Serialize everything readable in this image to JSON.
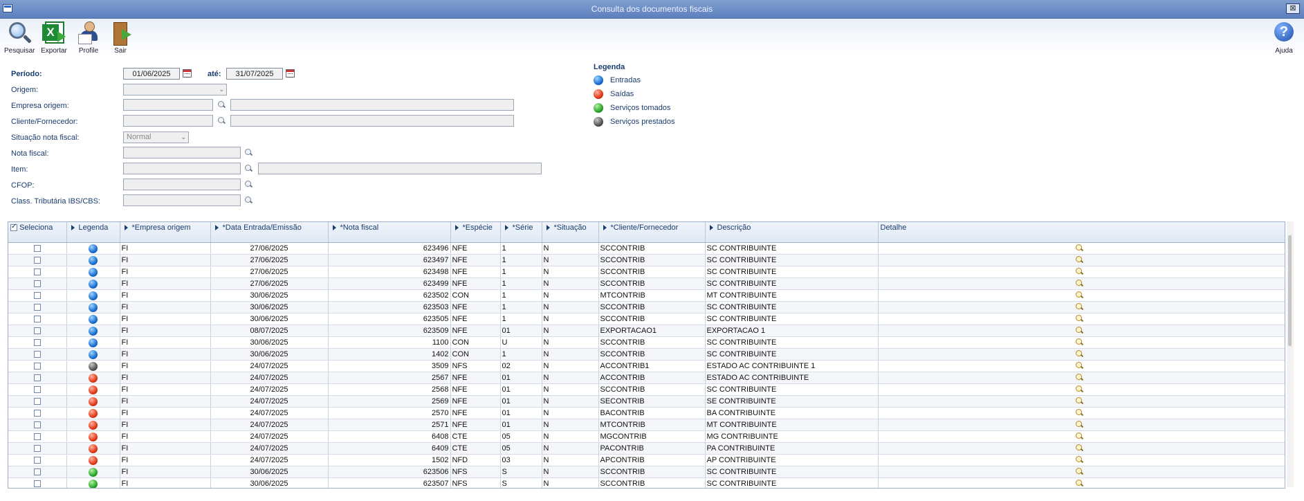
{
  "window": {
    "title": "Consulta dos documentos fiscais",
    "close_label": "⊠"
  },
  "toolbar": {
    "search_label": "Pesquisar",
    "export_label": "Exportar",
    "profile_label": "Profile",
    "exit_label": "Sair",
    "help_label": "Ajuda"
  },
  "filters": {
    "periodo_label": "Período:",
    "periodo_start": "01/06/2025",
    "ate_label": "até:",
    "periodo_end": "31/07/2025",
    "origem_label": "Origem:",
    "origem_value": "",
    "empresa_origem_label": "Empresa origem:",
    "empresa_origem_code": "",
    "empresa_origem_name": "",
    "cliente_label": "Cliente/Fornecedor:",
    "cliente_code": "",
    "cliente_name": "",
    "situacao_label": "Situação nota fiscal:",
    "situacao_value": "Normal",
    "nota_fiscal_label": "Nota fiscal:",
    "nota_fiscal_value": "",
    "item_label": "Item:",
    "item_code": "",
    "item_name": "",
    "cfop_label": "CFOP:",
    "cfop_value": "",
    "class_trib_label": "Class. Tributária IBS/CBS:",
    "class_trib_value": ""
  },
  "legend": {
    "title": "Legenda",
    "items": [
      {
        "label": "Entradas",
        "color": "blue"
      },
      {
        "label": "Saídas",
        "color": "red"
      },
      {
        "label": "Serviços tomados",
        "color": "green"
      },
      {
        "label": "Serviços prestados",
        "color": "gray"
      }
    ]
  },
  "grid": {
    "columns": [
      "Seleciona",
      "Legenda",
      "*Empresa origem",
      "*Data Entrada/Emissão",
      "*Nota fiscal",
      "*Espécie",
      "*Série",
      "*Situação",
      "*Cliente/Fornecedor",
      "Descrição",
      "Detalhe"
    ],
    "rows": [
      {
        "legend": "blue",
        "empresa": "FI",
        "data": "27/06/2025",
        "nota": "623496",
        "especie": "NFE",
        "serie": "1",
        "situacao": "N",
        "cliente": "SCCONTRIB",
        "descricao": "SC CONTRIBUINTE"
      },
      {
        "legend": "blue",
        "empresa": "FI",
        "data": "27/06/2025",
        "nota": "623497",
        "especie": "NFE",
        "serie": "1",
        "situacao": "N",
        "cliente": "SCCONTRIB",
        "descricao": "SC CONTRIBUINTE"
      },
      {
        "legend": "blue",
        "empresa": "FI",
        "data": "27/06/2025",
        "nota": "623498",
        "especie": "NFE",
        "serie": "1",
        "situacao": "N",
        "cliente": "SCCONTRIB",
        "descricao": "SC CONTRIBUINTE"
      },
      {
        "legend": "blue",
        "empresa": "FI",
        "data": "27/06/2025",
        "nota": "623499",
        "especie": "NFE",
        "serie": "1",
        "situacao": "N",
        "cliente": "SCCONTRIB",
        "descricao": "SC CONTRIBUINTE"
      },
      {
        "legend": "blue",
        "empresa": "FI",
        "data": "30/06/2025",
        "nota": "623502",
        "especie": "CON",
        "serie": "1",
        "situacao": "N",
        "cliente": "MTCONTRIB",
        "descricao": "MT CONTRIBUINTE"
      },
      {
        "legend": "blue",
        "empresa": "FI",
        "data": "30/06/2025",
        "nota": "623503",
        "especie": "NFE",
        "serie": "1",
        "situacao": "N",
        "cliente": "SCCONTRIB",
        "descricao": "SC CONTRIBUINTE"
      },
      {
        "legend": "blue",
        "empresa": "FI",
        "data": "30/06/2025",
        "nota": "623505",
        "especie": "NFE",
        "serie": "1",
        "situacao": "N",
        "cliente": "SCCONTRIB",
        "descricao": "SC CONTRIBUINTE"
      },
      {
        "legend": "blue",
        "empresa": "FI",
        "data": "08/07/2025",
        "nota": "623509",
        "especie": "NFE",
        "serie": "01",
        "situacao": "N",
        "cliente": "EXPORTACAO1",
        "descricao": "EXPORTACAO 1"
      },
      {
        "legend": "blue",
        "empresa": "FI",
        "data": "30/06/2025",
        "nota": "1100",
        "especie": "CON",
        "serie": "U",
        "situacao": "N",
        "cliente": "SCCONTRIB",
        "descricao": "SC CONTRIBUINTE"
      },
      {
        "legend": "blue",
        "empresa": "FI",
        "data": "30/06/2025",
        "nota": "1402",
        "especie": "CON",
        "serie": "1",
        "situacao": "N",
        "cliente": "SCCONTRIB",
        "descricao": "SC CONTRIBUINTE"
      },
      {
        "legend": "gray",
        "empresa": "FI",
        "data": "24/07/2025",
        "nota": "3509",
        "especie": "NFS",
        "serie": "02",
        "situacao": "N",
        "cliente": "ACCONTRIB1",
        "descricao": "ESTADO AC CONTRIBUINTE 1"
      },
      {
        "legend": "red",
        "empresa": "FI",
        "data": "24/07/2025",
        "nota": "2567",
        "especie": "NFE",
        "serie": "01",
        "situacao": "N",
        "cliente": "ACCONTRIB",
        "descricao": "ESTADO AC CONTRIBUINTE"
      },
      {
        "legend": "red",
        "empresa": "FI",
        "data": "24/07/2025",
        "nota": "2568",
        "especie": "NFE",
        "serie": "01",
        "situacao": "N",
        "cliente": "SCCONTRIB",
        "descricao": "SC CONTRIBUINTE"
      },
      {
        "legend": "red",
        "empresa": "FI",
        "data": "24/07/2025",
        "nota": "2569",
        "especie": "NFE",
        "serie": "01",
        "situacao": "N",
        "cliente": "SECONTRIB",
        "descricao": "SE CONTRIBUINTE"
      },
      {
        "legend": "red",
        "empresa": "FI",
        "data": "24/07/2025",
        "nota": "2570",
        "especie": "NFE",
        "serie": "01",
        "situacao": "N",
        "cliente": "BACONTRIB",
        "descricao": "BA CONTRIBUINTE"
      },
      {
        "legend": "red",
        "empresa": "FI",
        "data": "24/07/2025",
        "nota": "2571",
        "especie": "NFE",
        "serie": "01",
        "situacao": "N",
        "cliente": "MTCONTRIB",
        "descricao": "MT CONTRIBUINTE"
      },
      {
        "legend": "red",
        "empresa": "FI",
        "data": "24/07/2025",
        "nota": "6408",
        "especie": "CTE",
        "serie": "05",
        "situacao": "N",
        "cliente": "MGCONTRIB",
        "descricao": "MG CONTRIBUINTE"
      },
      {
        "legend": "red",
        "empresa": "FI",
        "data": "24/07/2025",
        "nota": "6409",
        "especie": "CTE",
        "serie": "05",
        "situacao": "N",
        "cliente": "PACONTRIB",
        "descricao": "PA CONTRIBUINTE"
      },
      {
        "legend": "red",
        "empresa": "FI",
        "data": "24/07/2025",
        "nota": "1502",
        "especie": "NFD",
        "serie": "03",
        "situacao": "N",
        "cliente": "APCONTRIB",
        "descricao": "AP CONTRIBUINTE"
      },
      {
        "legend": "green",
        "empresa": "FI",
        "data": "30/06/2025",
        "nota": "623506",
        "especie": "NFS",
        "serie": "S",
        "situacao": "N",
        "cliente": "SCCONTRIB",
        "descricao": "SC CONTRIBUINTE"
      },
      {
        "legend": "green",
        "empresa": "FI",
        "data": "30/06/2025",
        "nota": "623507",
        "especie": "NFS",
        "serie": "S",
        "situacao": "N",
        "cliente": "SCCONTRIB",
        "descricao": "SC CONTRIBUINTE"
      }
    ]
  }
}
